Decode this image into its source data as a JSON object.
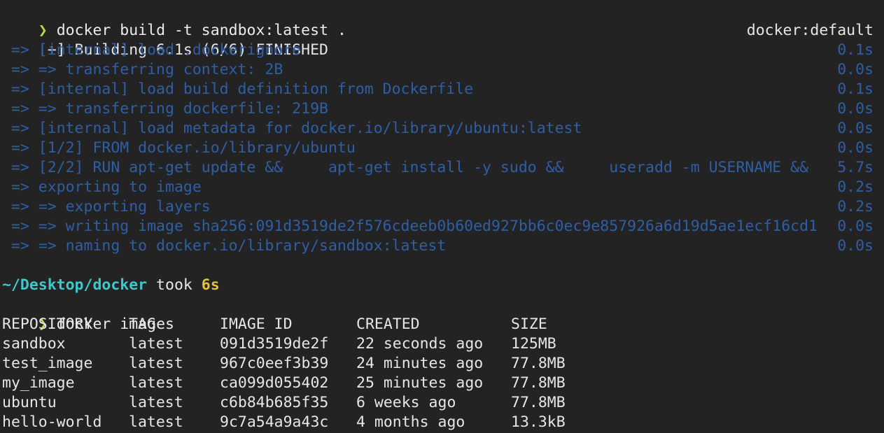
{
  "build": {
    "prompt_symbol": "❯",
    "command": "docker build -t sandbox:latest .",
    "status": "[+] Building 6.1s (6/6) FINISHED",
    "builder": "docker:default",
    "steps": [
      {
        "text": " => [internal] load .dockerignore",
        "time": "0.1s"
      },
      {
        "text": " => => transferring context: 2B",
        "time": "0.0s"
      },
      {
        "text": " => [internal] load build definition from Dockerfile",
        "time": "0.1s"
      },
      {
        "text": " => => transferring dockerfile: 219B",
        "time": "0.0s"
      },
      {
        "text": " => [internal] load metadata for docker.io/library/ubuntu:latest",
        "time": "0.0s"
      },
      {
        "text": " => [1/2] FROM docker.io/library/ubuntu",
        "time": "0.0s"
      },
      {
        "text": " => [2/2] RUN apt-get update &&     apt-get install -y sudo &&     useradd -m USERNAME &&",
        "time": "5.7s"
      },
      {
        "text": " => exporting to image",
        "time": "0.2s"
      },
      {
        "text": " => => exporting layers",
        "time": "0.2s"
      },
      {
        "text": " => => writing image sha256:091d3519de2f576cdeeb0b60ed927bb6c0ec9e857926a6d19d5ae1ecf16cd1",
        "time": "0.0s"
      },
      {
        "text": " => => naming to docker.io/library/sandbox:latest",
        "time": "0.0s"
      }
    ]
  },
  "status_line": {
    "cwd": "~/Desktop/docker",
    "took_label": " took ",
    "duration": "6s"
  },
  "images_cmd": {
    "prompt_symbol": "❯",
    "command": "docker images"
  },
  "images_table": {
    "headers": [
      "REPOSITORY",
      "TAG",
      "IMAGE ID",
      "CREATED",
      "SIZE"
    ],
    "rows": [
      [
        "sandbox",
        "latest",
        "091d3519de2f",
        "22 seconds ago",
        "125MB"
      ],
      [
        "test_image",
        "latest",
        "967c0eef3b39",
        "24 minutes ago",
        "77.8MB"
      ],
      [
        "my_image",
        "latest",
        "ca099d055402",
        "25 minutes ago",
        "77.8MB"
      ],
      [
        "ubuntu",
        "latest",
        "c6b84b685f35",
        "6 weeks ago",
        "77.8MB"
      ],
      [
        "hello-world",
        "latest",
        "9c7a54a9a43c",
        "4 months ago",
        "13.3kB"
      ]
    ]
  },
  "colors": {
    "background": "#232323",
    "prompt": "#b8d94a",
    "step": "#2f5ea6",
    "cwd": "#3fc7c9",
    "duration": "#e0c23c"
  }
}
